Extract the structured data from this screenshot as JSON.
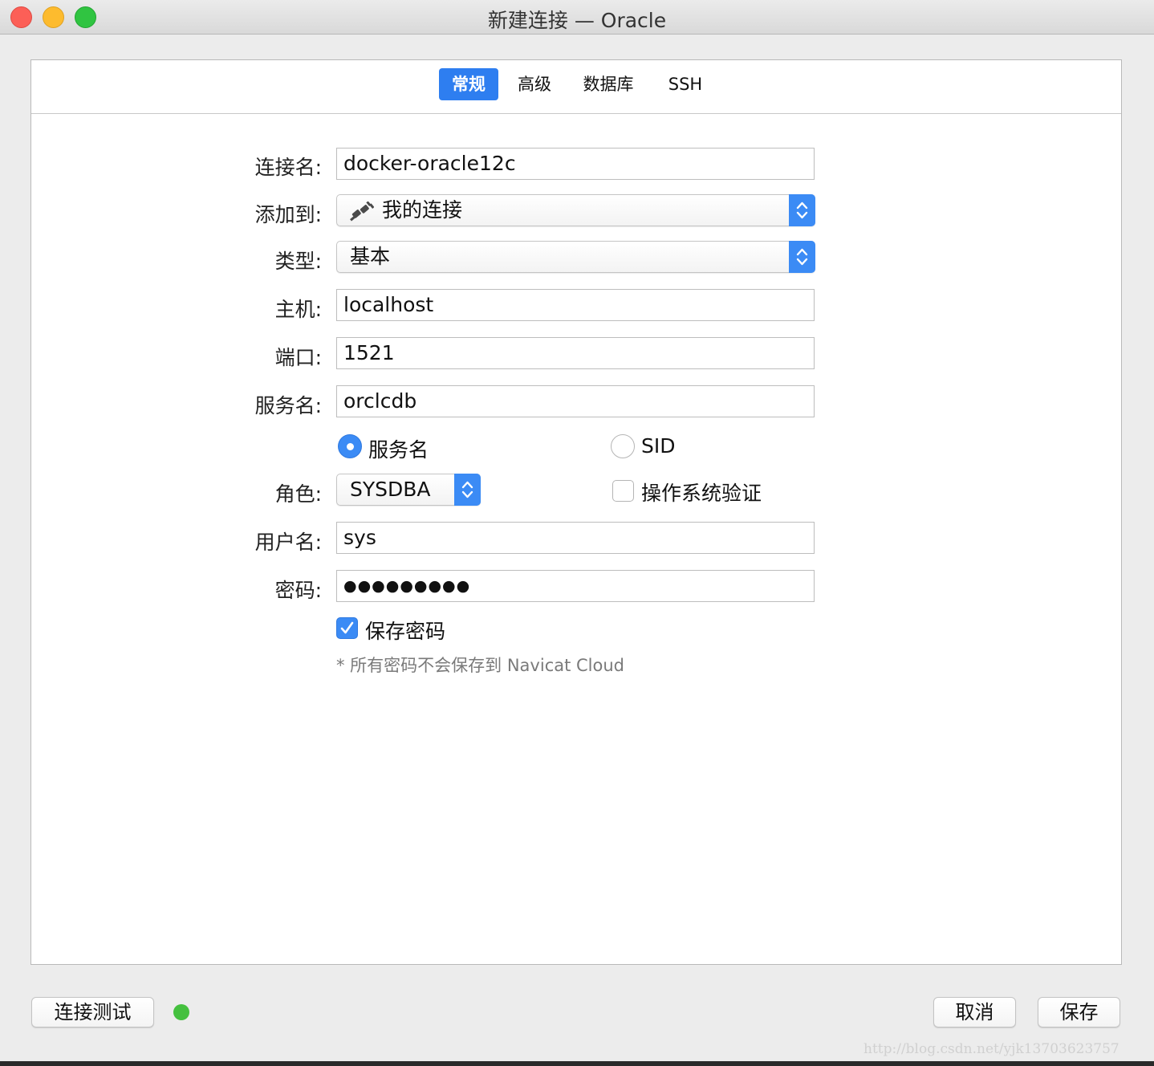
{
  "window": {
    "title": "新建连接 — Oracle"
  },
  "tabs": [
    "常规",
    "高级",
    "数据库",
    "SSH"
  ],
  "form": {
    "connection_name_label": "连接名:",
    "connection_name_value": "docker-oracle12c",
    "add_to_label": "添加到:",
    "add_to_value": "我的连接",
    "type_label": "类型:",
    "type_value": "基本",
    "host_label": "主机:",
    "host_value": "localhost",
    "port_label": "端口:",
    "port_value": "1521",
    "service_name_label": "服务名:",
    "service_name_value": "orclcdb",
    "radio_service_name": "服务名",
    "radio_sid": "SID",
    "role_label": "角色:",
    "role_value": "SYSDBA",
    "os_auth_label": "操作系统验证",
    "username_label": "用户名:",
    "username_value": "sys",
    "password_label": "密码:",
    "password_value": "●●●●●●●●●",
    "save_password_label": "保存密码",
    "note": "* 所有密码不会保存到 Navicat Cloud"
  },
  "footer": {
    "test_connection_label": "连接测试",
    "cancel_label": "取消",
    "save_label": "保存"
  },
  "watermark": "http://blog.csdn.net/yjk13703623757",
  "colors": {
    "accent": "#3b8bf5",
    "status_ok": "#44c03e"
  },
  "icons": {
    "add_to": "plug-icon",
    "stepper": "chevron-updown-icon"
  }
}
